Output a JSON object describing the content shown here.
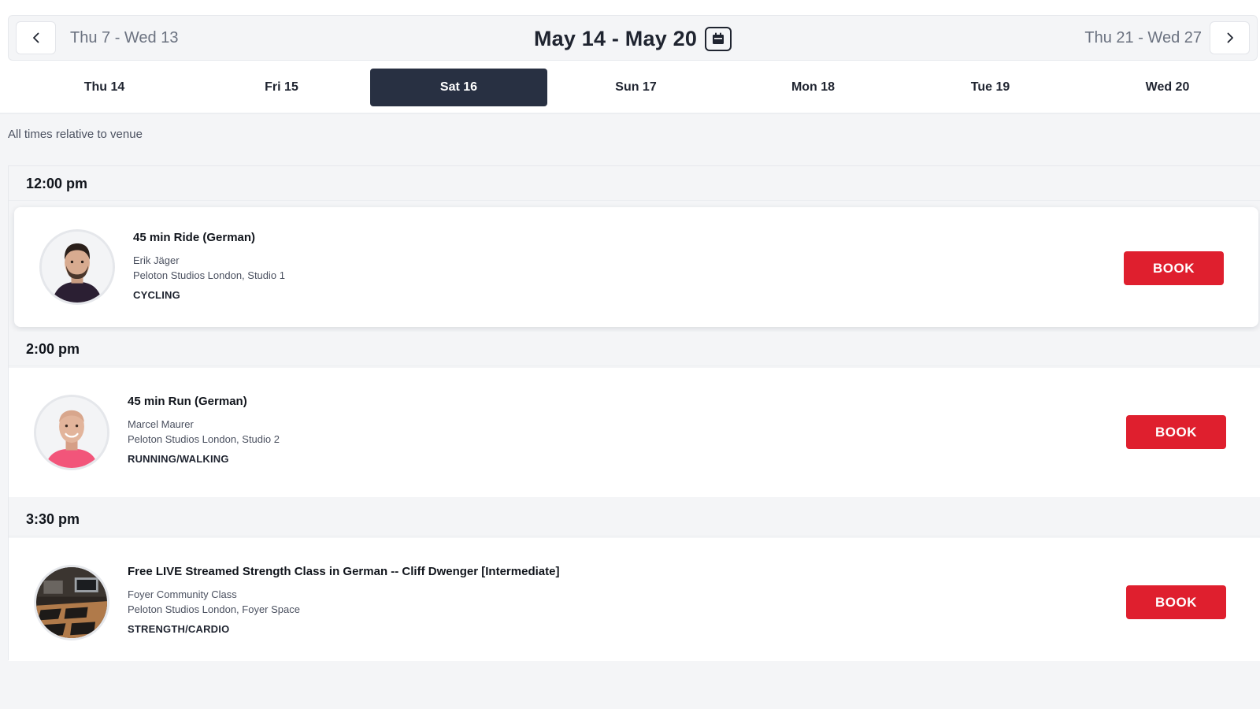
{
  "week_nav": {
    "prev_week": "Thu 7 - Wed 13",
    "current_week": "May 14 - May 20",
    "next_week": "Thu 21 - Wed 27"
  },
  "days": [
    {
      "label": "Thu 14",
      "active": false
    },
    {
      "label": "Fri 15",
      "active": false
    },
    {
      "label": "Sat 16",
      "active": true
    },
    {
      "label": "Sun 17",
      "active": false
    },
    {
      "label": "Mon 18",
      "active": false
    },
    {
      "label": "Tue 19",
      "active": false
    },
    {
      "label": "Wed 20",
      "active": false
    }
  ],
  "timezone_note": "All times relative to venue",
  "slots": [
    {
      "time": "12:00 pm",
      "class": {
        "title": "45 min Ride (German)",
        "instructor": "Erik Jäger",
        "location": "Peloton Studios London, Studio 1",
        "category": "CYCLING",
        "book_label": "BOOK"
      }
    },
    {
      "time": "2:00 pm",
      "class": {
        "title": "45 min Run (German)",
        "instructor": "Marcel Maurer",
        "location": "Peloton Studios London, Studio 2",
        "category": "RUNNING/WALKING",
        "book_label": "BOOK"
      }
    },
    {
      "time": "3:30 pm",
      "class": {
        "title": "Free LIVE Streamed Strength Class in German -- Cliff Dwenger [Intermediate]",
        "instructor": "Foyer Community Class",
        "location": "Peloton Studios London, Foyer Space",
        "category": "STRENGTH/CARDIO",
        "book_label": "BOOK"
      }
    }
  ],
  "colors": {
    "active_tab": "#283042",
    "book_button": "#df1f2e",
    "page_background": "#f4f5f7"
  }
}
